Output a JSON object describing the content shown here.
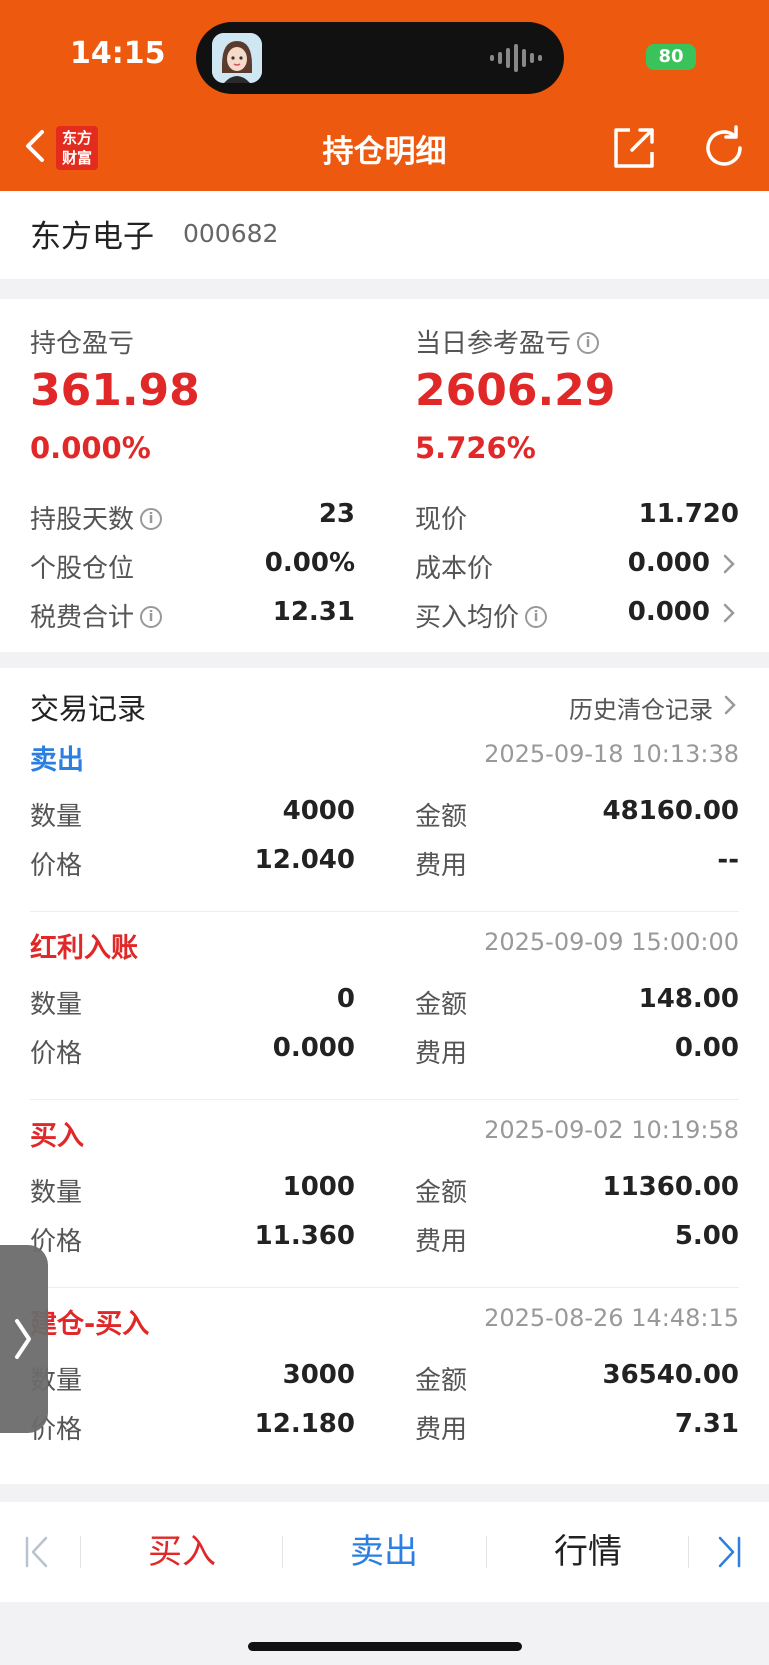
{
  "status": {
    "time": "14:15",
    "battery": "80"
  },
  "header": {
    "logo_line1": "东方",
    "logo_line2": "财富",
    "title": "持仓明细"
  },
  "stock": {
    "name": "东方电子",
    "code": "000682"
  },
  "profit": {
    "position_label": "持仓盈亏",
    "position_value": "361.98",
    "position_pct": "0.000%",
    "daily_label": "当日参考盈亏",
    "daily_value": "2606.29",
    "daily_pct": "5.726%",
    "hold_days_label": "持股天数",
    "hold_days": "23",
    "weight_label": "个股仓位",
    "weight": "0.00%",
    "tax_label": "税费合计",
    "tax": "12.31",
    "price_label": "现价",
    "price": "11.720",
    "cost_label": "成本价",
    "cost": "0.000",
    "avg_label": "买入均价",
    "avg": "0.000",
    "info_glyph": "i"
  },
  "trades": {
    "title": "交易记录",
    "history_link": "历史清仓记录",
    "labels": {
      "qty": "数量",
      "price": "价格",
      "amount": "金额",
      "fee": "费用"
    },
    "colors": {
      "sell": "#2a7fe0",
      "buy": "#e02828"
    },
    "items": [
      {
        "type": "卖出",
        "time": "2025-09-18 10:13:38",
        "qty": "4000",
        "price": "12.040",
        "amount": "48160.00",
        "fee": "--"
      },
      {
        "type": "红利入账",
        "time": "2025-09-09 15:00:00",
        "qty": "0",
        "price": "0.000",
        "amount": "148.00",
        "fee": "0.00"
      },
      {
        "type": "买入",
        "time": "2025-09-02 10:19:58",
        "qty": "1000",
        "price": "11.360",
        "amount": "11360.00",
        "fee": "5.00"
      },
      {
        "type": "建仓-买入",
        "time": "2025-08-26 14:48:15",
        "qty": "3000",
        "price": "12.180",
        "amount": "36540.00",
        "fee": "7.31"
      }
    ]
  },
  "bottom_bar": {
    "buy": "买入",
    "sell": "卖出",
    "market": "行情"
  }
}
